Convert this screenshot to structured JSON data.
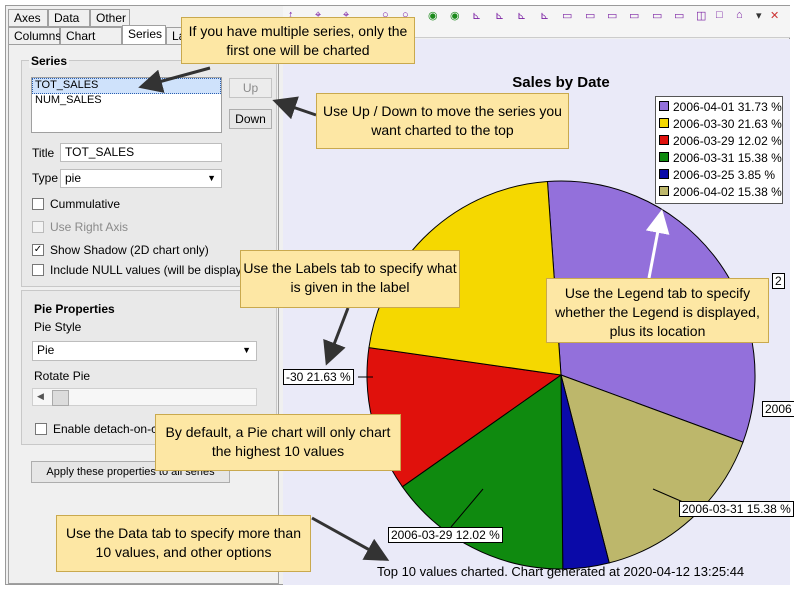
{
  "tabs_row1": [
    "Axes",
    "Data",
    "Other"
  ],
  "tabs_row2": [
    "Columns",
    "Chart Type",
    "Series",
    "La"
  ],
  "series": {
    "group_title": "Series",
    "list": [
      "TOT_SALES",
      "NUM_SALES"
    ],
    "up_label": "Up",
    "down_label": "Down",
    "title_label": "Title",
    "title_value": "TOT_SALES",
    "type_label": "Type",
    "type_value": "pie",
    "cumulative": "Cummulative",
    "right_axis": "Use Right Axis",
    "shadow": "Show Shadow (2D chart only)",
    "nulls": "Include NULL values (will be displayed a"
  },
  "pie": {
    "group_title": "Pie Properties",
    "style_label": "Pie Style",
    "style_value": "Pie",
    "rotate_label": "Rotate Pie",
    "detach_label": "Enable detach-on-clic"
  },
  "apply_label": "Apply these properties to all series",
  "chart": {
    "title": "Sales by Date",
    "footer": "Top 10 values charted. Chart generated at 2020-04-12 13:25:44",
    "legend": [
      {
        "label": "2006-04-01 31.73 %",
        "color": "#9370db"
      },
      {
        "label": "2006-03-30 21.63 %",
        "color": "#f5d800"
      },
      {
        "label": "2006-03-29 12.02 %",
        "color": "#e0110c"
      },
      {
        "label": "2006-03-31 15.38 %",
        "color": "#0f8a0f"
      },
      {
        "label": "2006-03-25 3.85 %",
        "color": "#0a0aa8"
      },
      {
        "label": "2006-04-02 15.38 %",
        "color": "#bdb76b"
      }
    ],
    "labels": {
      "l30": "-30 21.63 %",
      "l29": "2006-03-29 12.02 %",
      "l31": "2006-03-31 15.38 %",
      "l25": "2006",
      "l02": "2"
    }
  },
  "chart_data": {
    "type": "pie",
    "title": "Sales by Date",
    "categories": [
      "2006-04-01",
      "2006-03-30",
      "2006-03-29",
      "2006-03-31",
      "2006-03-25",
      "2006-04-02"
    ],
    "values": [
      31.73,
      21.63,
      12.02,
      15.38,
      3.85,
      15.38
    ],
    "legend": "top-right"
  },
  "notes": {
    "n1": "If you have multiple series, only the first one will be charted",
    "n2": "Use Up / Down to move the series you want charted to the top",
    "n3": "Use the Labels tab to specify what is given in the label",
    "n4": "Use the Legend tab to specify whether the Legend is displayed, plus its location",
    "n5": "By default, a Pie chart will only chart the highest 10 values",
    "n6": "Use the Data tab to specify more than 10 values, and other options"
  }
}
